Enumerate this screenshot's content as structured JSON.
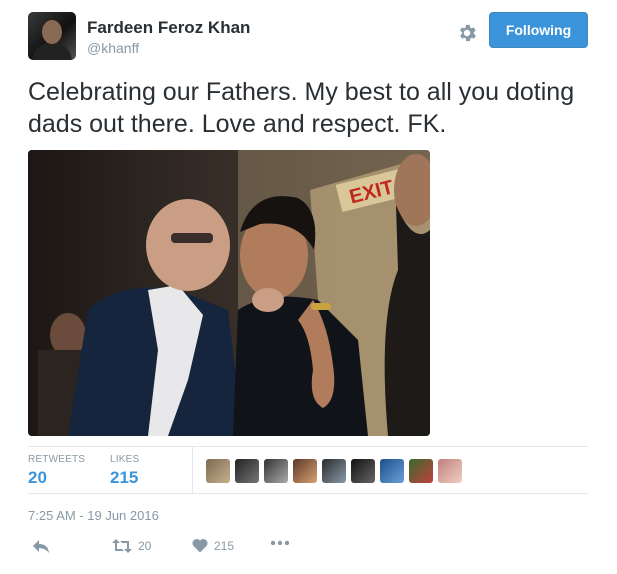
{
  "tweet": {
    "author_name": "Fardeen Feroz Khan",
    "handle": "@khanff",
    "follow_button_label": "Following",
    "text": "Celebrating our Fathers. My best to all you doting dads out there. Love and respect. FK.",
    "photo_sign_text": "EXIT",
    "timestamp": "7:25 AM - 19 Jun 2016"
  },
  "stats": {
    "retweets_label": "RETWEETS",
    "retweets_value": "20",
    "likes_label": "LIKES",
    "likes_value": "215"
  },
  "actions": {
    "retweet_count": "20",
    "like_count": "215"
  },
  "colors": {
    "accent": "#3b94d9",
    "muted": "#8899a6",
    "text": "#292f33",
    "divider": "#e1e8ed"
  },
  "icons": [
    "gear-icon",
    "reply-icon",
    "retweet-icon",
    "heart-icon",
    "more-icon"
  ]
}
